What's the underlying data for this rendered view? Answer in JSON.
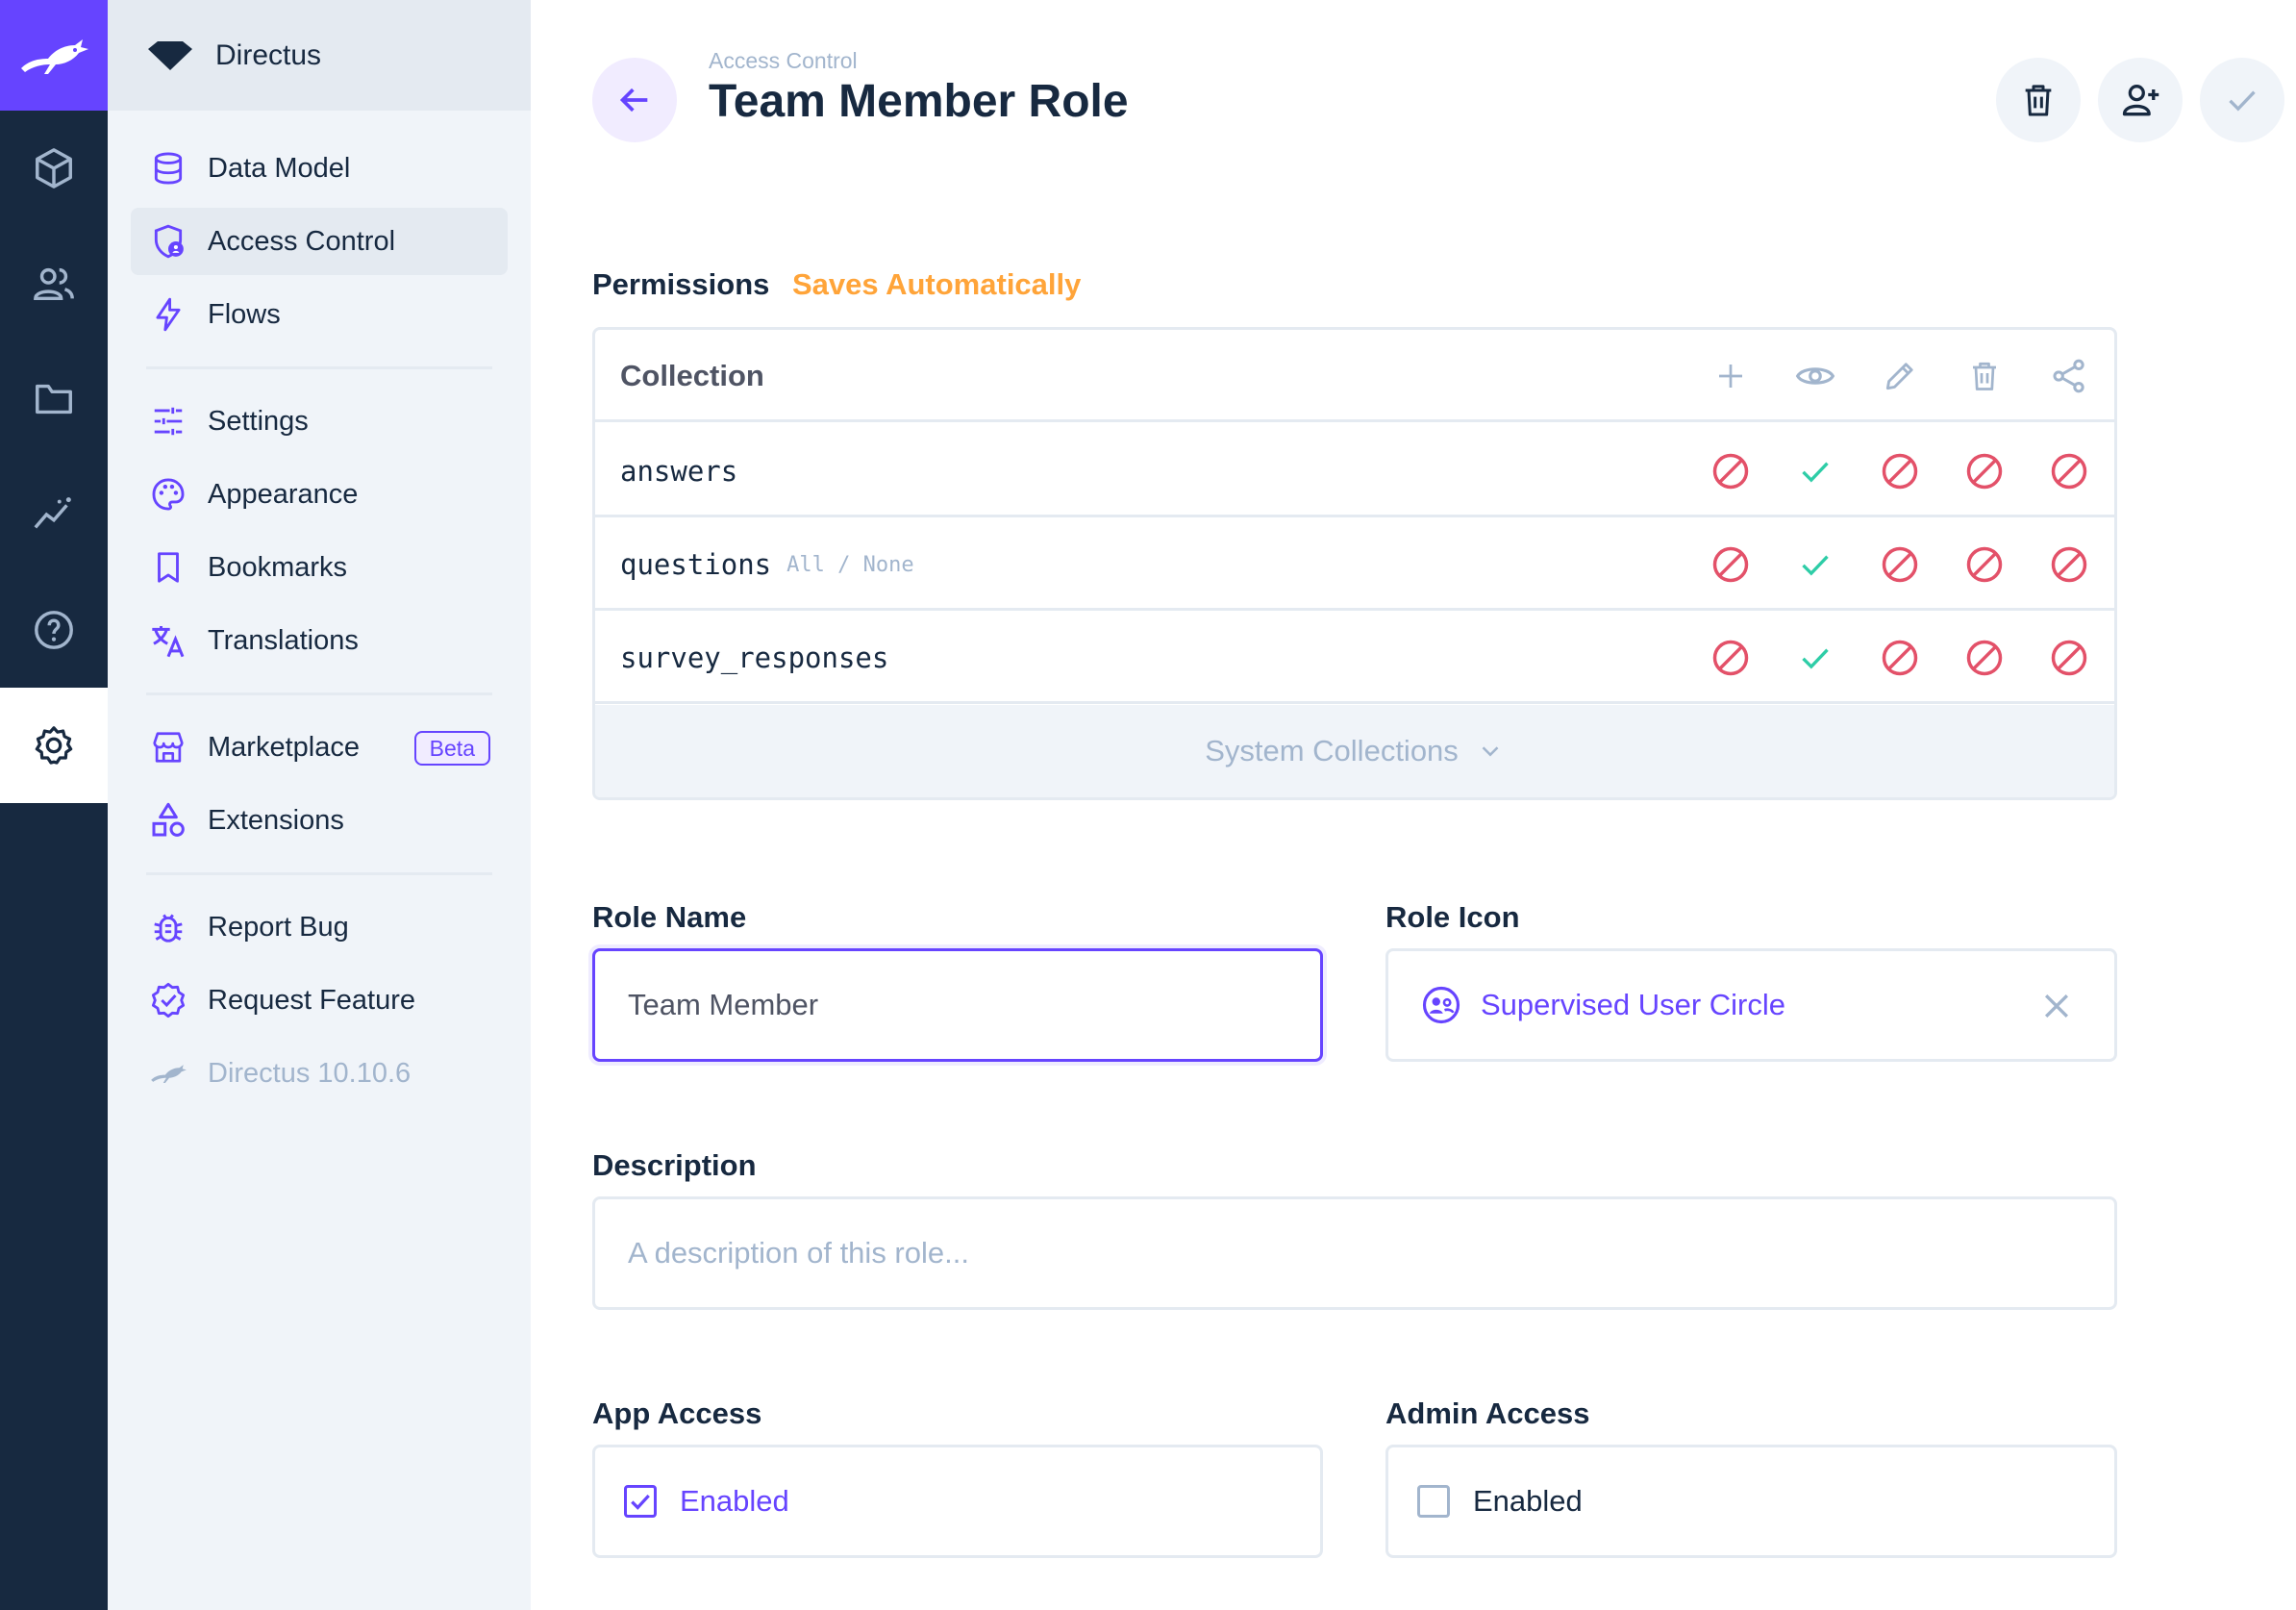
{
  "project": {
    "name": "Directus"
  },
  "modules": [
    "content-icon",
    "users-icon",
    "files-icon",
    "insights-icon",
    "help-icon",
    "settings-icon"
  ],
  "nav": {
    "items": [
      {
        "label": "Data Model",
        "icon": "database-icon"
      },
      {
        "label": "Access Control",
        "icon": "access-shield-icon"
      },
      {
        "label": "Flows",
        "icon": "bolt-icon"
      },
      {
        "label": "Settings",
        "icon": "tune-icon"
      },
      {
        "label": "Appearance",
        "icon": "palette-icon"
      },
      {
        "label": "Bookmarks",
        "icon": "bookmark-icon"
      },
      {
        "label": "Translations",
        "icon": "translate-icon"
      },
      {
        "label": "Marketplace",
        "icon": "storefront-icon",
        "badge": "Beta"
      },
      {
        "label": "Extensions",
        "icon": "category-icon"
      },
      {
        "label": "Report Bug",
        "icon": "bug-icon"
      },
      {
        "label": "Request Feature",
        "icon": "verified-icon"
      },
      {
        "label": "Directus 10.10.6",
        "icon": "directus-rabbit-icon"
      }
    ]
  },
  "header": {
    "breadcrumb": "Access Control",
    "title": "Team Member Role"
  },
  "permissions": {
    "label": "Permissions",
    "auto_label": "Saves Automatically",
    "column_header": "Collection",
    "actions": [
      "create",
      "read",
      "update",
      "delete",
      "share"
    ],
    "rows": [
      {
        "collection": "answers",
        "all_none": "",
        "perms": [
          "none",
          "all",
          "none",
          "none",
          "none"
        ]
      },
      {
        "collection": "questions",
        "all_none": "All / None",
        "perms": [
          "none",
          "all",
          "none",
          "none",
          "none"
        ]
      },
      {
        "collection": "survey_responses",
        "all_none": "",
        "perms": [
          "none",
          "all",
          "none",
          "none",
          "none"
        ]
      }
    ],
    "system_label": "System Collections"
  },
  "form": {
    "role_name_label": "Role Name",
    "role_name_value": "Team Member",
    "role_icon_label": "Role Icon",
    "role_icon_value": "Supervised User Circle",
    "description_label": "Description",
    "description_placeholder": "A description of this role...",
    "app_access_label": "App Access",
    "app_access_text": "Enabled",
    "app_access_checked": true,
    "admin_access_label": "Admin Access",
    "admin_access_text": "Enabled",
    "admin_access_checked": false
  },
  "colors": {
    "accent": "#6644ff",
    "danger": "#e35169",
    "success": "#2ecda7",
    "warning": "#ffa439"
  }
}
